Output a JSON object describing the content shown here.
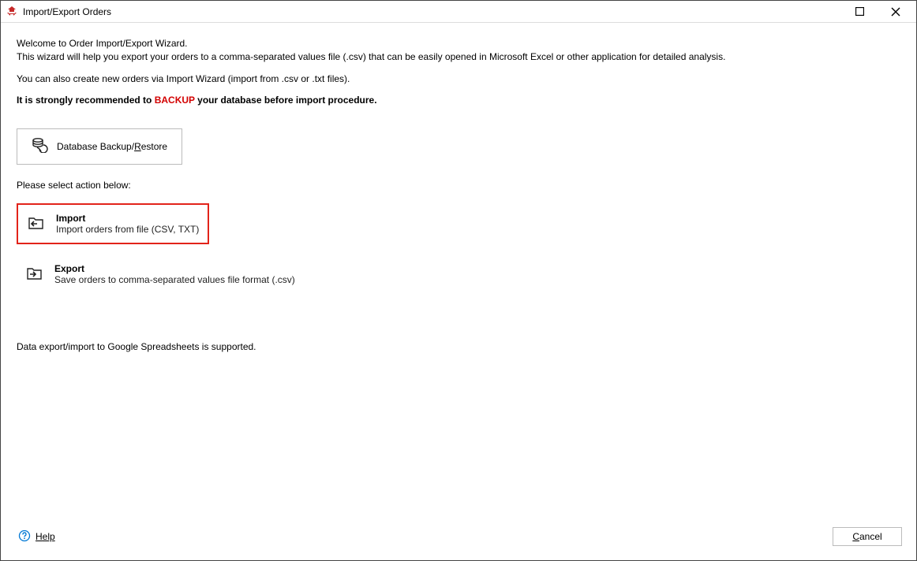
{
  "titlebar": {
    "title": "Import/Export Orders"
  },
  "intro": {
    "line1": "Welcome to Order Import/Export Wizard.",
    "line2": "This wizard will help you export your orders to a comma-separated values file (.csv) that can be easily opened in Microsoft Excel or other application for detailed analysis.",
    "line3": "You can also create new orders via Import Wizard (import from .csv or .txt files).",
    "strong_prefix": "It is strongly recommended to ",
    "backup_word": "BACKUP",
    "strong_suffix": " your database before import procedure."
  },
  "backup_button": {
    "prefix": "Database Backup/",
    "underline": "R",
    "suffix": "estore"
  },
  "select_label": "Please select action below:",
  "options": {
    "import": {
      "title": "Import",
      "desc": "Import orders from file (CSV, TXT)"
    },
    "export": {
      "title": "Export",
      "desc": "Save orders to comma-separated values file format (.csv)"
    }
  },
  "footer_note": "Data export/import to Google Spreadsheets is supported.",
  "bottom": {
    "help_prefix": "H",
    "help_suffix": "elp",
    "cancel_prefix": "C",
    "cancel_suffix": "ancel"
  }
}
